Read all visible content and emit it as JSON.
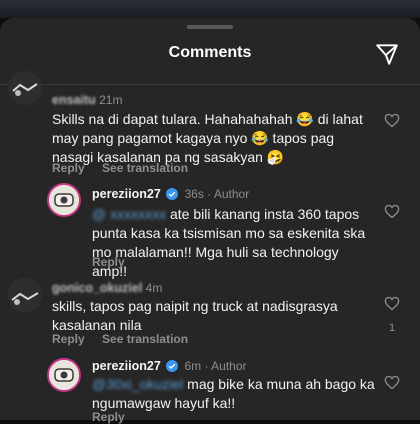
{
  "sheet": {
    "title": "Comments"
  },
  "comments": [
    {
      "username": "ensaitu",
      "time": "21m",
      "text": "Skills na di dapat tulara. Hahahahahah 😂 di lahat may pang pagamot kagaya nyo 😂 tapos pag nasagi kasalanan pa ng sasakyan 🤧",
      "reply_label": "Reply",
      "translate_label": "See translation"
    },
    {
      "username": "pereziion27",
      "time": "36s",
      "author_label": "Author",
      "mention": "@",
      "text": "ate bili kanang insta 360 tapos punta kasa ka tsismisan mo sa eskenita ska mo malalaman!! Mga huli sa technology amp!!",
      "reply_label": "Reply"
    },
    {
      "username": "gonico_okuziel",
      "time": "4m",
      "text": "skills, tapos pag naipit ng truck at nadisgrasya kasalanan nila",
      "reply_label": "Reply",
      "translate_label": "See translation",
      "likes": "1"
    },
    {
      "username": "pereziion27",
      "time": "6m",
      "author_label": "Author",
      "mention": "@30xi_okuziel",
      "text": "mag bike ka muna ah bago ka ngumawgaw hayuf ka!!",
      "reply_label": "Reply"
    }
  ],
  "icons": {
    "share": "send-icon",
    "like": "heart-icon",
    "verified": "verified-badge-icon"
  },
  "colors": {
    "background": "#262626",
    "verified": "#3897f0",
    "muted": "#8e8e8e"
  }
}
